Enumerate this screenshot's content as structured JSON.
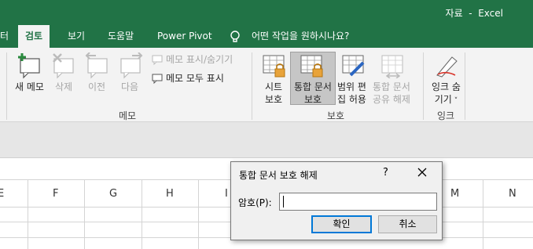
{
  "window": {
    "title": "자료  -  Excel"
  },
  "tabs": [
    {
      "label": "터",
      "active": false
    },
    {
      "label": "검토",
      "active": true
    },
    {
      "label": "보기",
      "active": false
    },
    {
      "label": "도움말",
      "active": false
    },
    {
      "label": "Power Pivot",
      "active": false
    }
  ],
  "tellme": {
    "placeholder": "어떤 작업을 원하시나요?"
  },
  "ribbon": {
    "memo_group": {
      "label": "메모",
      "new_memo": "새 메모",
      "delete": "삭제",
      "previous": "이전",
      "next": "다음",
      "show_hide_memo": "메모 표시/숨기기",
      "show_all_memos": "메모 모두 표시"
    },
    "protect_group": {
      "label": "보호",
      "sheet_protect_line1": "시트",
      "sheet_protect_line2": "보호",
      "workbook_protect_line1": "통합 문서",
      "workbook_protect_line2": "보호",
      "allow_ranges_line1": "범위 편",
      "allow_ranges_line2": "집 허용",
      "unshare_line1": "통합 문서",
      "unshare_line2": "공유 해제"
    },
    "ink_group": {
      "label": "잉크",
      "hide_ink_line1": "잉크 숨",
      "hide_ink_line2": "기기"
    }
  },
  "columns": [
    "E",
    "F",
    "G",
    "H",
    "I",
    "M",
    "N"
  ],
  "dialog": {
    "title": "통합 문서 보호 해제",
    "help": "?",
    "password_label": "암호(P):",
    "password_value": "",
    "ok": "확인",
    "cancel": "취소"
  },
  "colors": {
    "excel_green": "#217346",
    "ribbon_bg": "#f3f3f3",
    "focus_blue": "#0078d7"
  }
}
